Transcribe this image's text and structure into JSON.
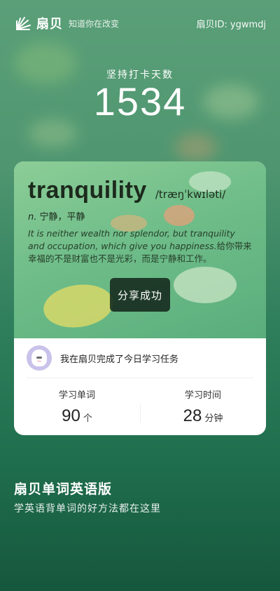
{
  "brand": {
    "name": "扇贝",
    "slogan": "知道你在改变",
    "user_id": "扇贝ID: ygwmdj"
  },
  "streak": {
    "label": "坚持打卡天数",
    "days": "1534"
  },
  "card": {
    "word": "tranquility",
    "phonetic": "/træŋˈkwɪləti/",
    "part_of_speech": "n.",
    "definition": "宁静，平静",
    "quote_en": "It is neither wealth nor splendor, but tranquility and occupation, which give you happiness.",
    "quote_zh": "给你带来幸福的不是财富也不是光彩，而是宁静和工作。",
    "share_toast": "分享成功",
    "user_message": "我在扇贝完成了今日学习任务",
    "stats": [
      {
        "label": "学习单词",
        "value": "90",
        "unit": "个"
      },
      {
        "label": "学习时间",
        "value": "28",
        "unit": "分钟"
      }
    ]
  },
  "promo": {
    "title": "扇贝单词英语版",
    "subtitle": "学英语背单词的好方法都在这里"
  },
  "colors": {
    "background_top": "#5a9f78",
    "background_bottom": "#16573d",
    "toast_bg": "#1e3326"
  }
}
